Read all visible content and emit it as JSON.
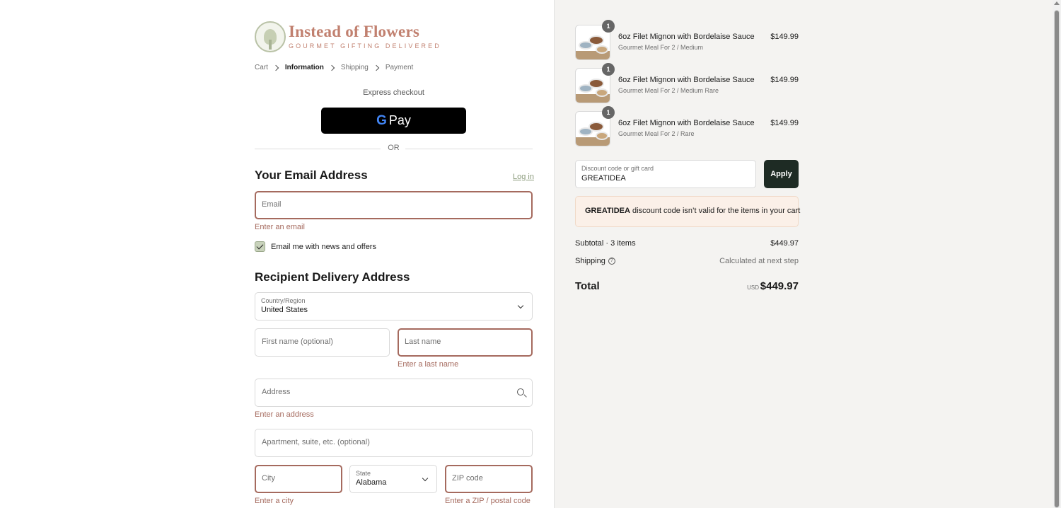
{
  "brand": {
    "title": "Instead of Flowers",
    "subtitle": "GOURMET GIFTING DELIVERED"
  },
  "breadcrumb": {
    "cart": "Cart",
    "information": "Information",
    "shipping": "Shipping",
    "payment": "Payment"
  },
  "express": {
    "label": "Express checkout",
    "gpay_g": "G",
    "gpay_pay": "Pay",
    "or": "OR"
  },
  "email_section": {
    "title": "Your Email Address",
    "login": "Log in",
    "email_placeholder": "Email",
    "email_error": "Enter an email",
    "newsletter_label": "Email me with news and offers",
    "newsletter_checked": true
  },
  "delivery_section": {
    "title": "Recipient Delivery Address",
    "country_label": "Country/Region",
    "country_value": "United States",
    "first_name_placeholder": "First name (optional)",
    "last_name_placeholder": "Last name",
    "last_name_error": "Enter a last name",
    "address_placeholder": "Address",
    "address_error": "Enter an address",
    "apartment_placeholder": "Apartment, suite, etc. (optional)",
    "city_placeholder": "City",
    "city_error": "Enter a city",
    "state_label": "State",
    "state_value": "Alabama",
    "zip_placeholder": "ZIP code",
    "zip_error": "Enter a ZIP / postal code"
  },
  "cart_items": [
    {
      "qty": "1",
      "name": "6oz Filet Mignon with Bordelaise Sauce",
      "variant": "Gourmet Meal For 2 / Medium",
      "price": "$149.99"
    },
    {
      "qty": "1",
      "name": "6oz Filet Mignon with Bordelaise Sauce",
      "variant": "Gourmet Meal For 2 / Medium Rare",
      "price": "$149.99"
    },
    {
      "qty": "1",
      "name": "6oz Filet Mignon with Bordelaise Sauce",
      "variant": "Gourmet Meal For 2 / Rare",
      "price": "$149.99"
    }
  ],
  "discount": {
    "label": "Discount code or gift card",
    "value": "GREATIDEA",
    "apply": "Apply",
    "alert_code": "GREATIDEA",
    "alert_text": " discount code isn’t valid for the items in your cart"
  },
  "summary": {
    "subtotal_label": "Subtotal · 3 items",
    "subtotal_value": "$449.97",
    "shipping_label": "Shipping",
    "shipping_help": "?",
    "shipping_value": "Calculated at next step",
    "total_label": "Total",
    "currency": "USD",
    "total_value": "$449.97"
  },
  "colors": {
    "brand": "#c1806f",
    "error": "#a56a5e",
    "button_dark": "#1e2b24",
    "sidebar_bg": "#f4f3f1",
    "alert_bg": "#fbf0e8"
  }
}
